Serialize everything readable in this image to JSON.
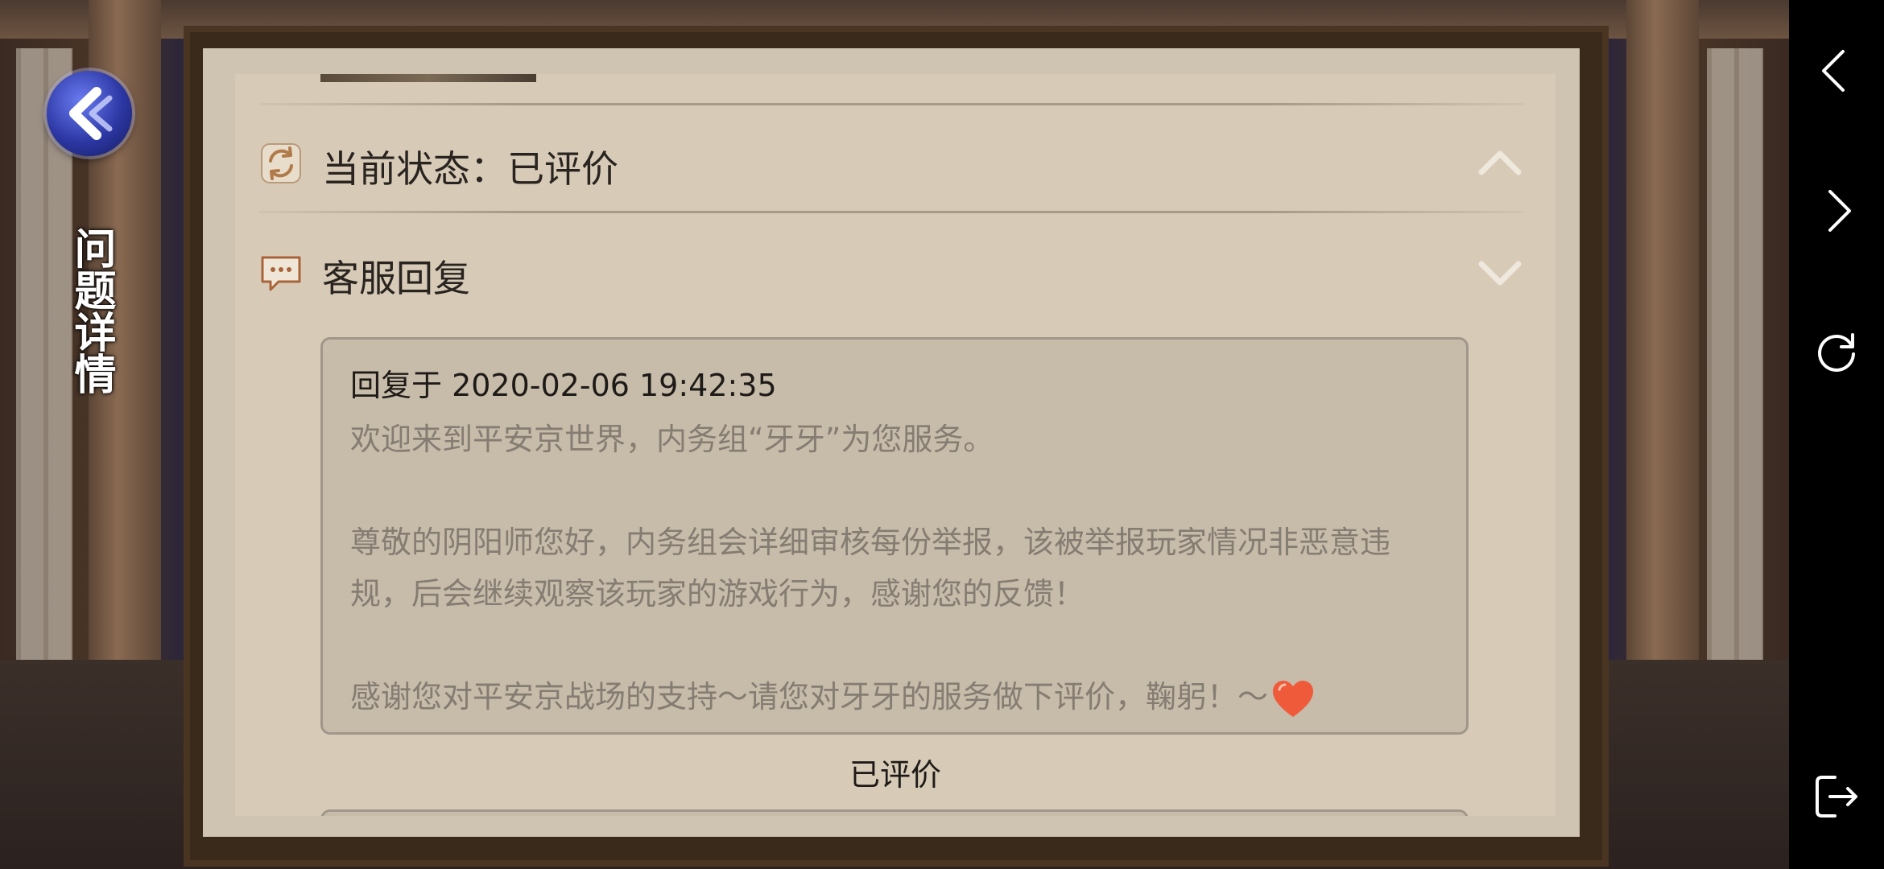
{
  "side": {
    "title": "问题详情"
  },
  "status_row": {
    "label": "当前状态：已评价",
    "icon": "refresh-icon",
    "chevron": "chevron-up-icon"
  },
  "reply_row": {
    "label": "客服回复",
    "icon": "chat-bubble-icon",
    "chevron": "chevron-down-icon"
  },
  "reply": {
    "time": "回复于 2020-02-06 19:42:35",
    "line1": "欢迎来到平安京世界，内务组“牙牙”为您服务。",
    "line2": "尊敬的阴阳师您好，内务组会详细审核每份举报，该被举报玩家情况非恶意违规，后会继续观察该玩家的游戏行为，感谢您的反馈！",
    "line3": "感谢您对平安京战场的支持～请您对牙牙的服务做下评价，鞠躬！～",
    "emoji": "heart-icon"
  },
  "rated_label": "已评价",
  "navbar": {
    "icons": [
      "back-arrow-icon",
      "forward-arrow-icon",
      "reload-icon",
      "exit-icon"
    ]
  },
  "colors": {
    "paper": "#d7cbb8",
    "reply_box": "#c7bcaa",
    "heart": "#ef5a3a"
  }
}
